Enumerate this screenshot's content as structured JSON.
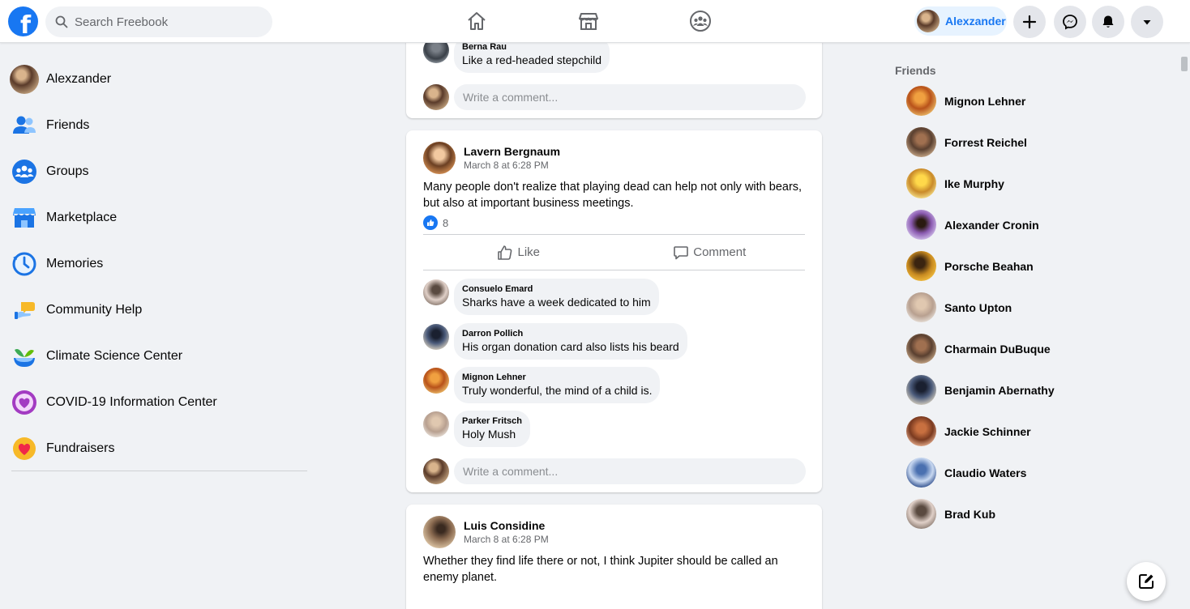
{
  "app": {
    "logo_letter": "f",
    "search_placeholder": "Search Freebook",
    "user_name": "Alexzander",
    "brand_color": "#1877f2"
  },
  "leftnav": {
    "items": [
      {
        "label": "Alexzander",
        "icon": "profile-avatar"
      },
      {
        "label": "Friends",
        "icon": "friends-icon"
      },
      {
        "label": "Groups",
        "icon": "groups-icon"
      },
      {
        "label": "Marketplace",
        "icon": "marketplace-icon"
      },
      {
        "label": "Memories",
        "icon": "memories-icon"
      },
      {
        "label": "Community Help",
        "icon": "community-help-icon"
      },
      {
        "label": "Climate Science Center",
        "icon": "climate-icon"
      },
      {
        "label": "COVID-19 Information Center",
        "icon": "covid-icon"
      },
      {
        "label": "Fundraisers",
        "icon": "fundraisers-icon"
      }
    ]
  },
  "feed": {
    "post0": {
      "comments": [
        {
          "name": "Berna Rau",
          "text": "Like a red-headed stepchild"
        }
      ],
      "write_placeholder": "Write a comment..."
    },
    "post1": {
      "author": "Lavern Bergnaum",
      "date": "March 8 at 6:28 PM",
      "text": "Many people don't realize that playing dead can help not only with bears, but also at important business meetings.",
      "like_count": "8",
      "like_label": "Like",
      "comment_label": "Comment",
      "comments": [
        {
          "name": "Consuelo Emard",
          "text": "Sharks have a week dedicated to him"
        },
        {
          "name": "Darron Pollich",
          "text": "His organ donation card also lists his beard"
        },
        {
          "name": "Mignon Lehner",
          "text": "Truly wonderful, the mind of a child is."
        },
        {
          "name": "Parker Fritsch",
          "text": "Holy Mush"
        }
      ],
      "write_placeholder": "Write a comment..."
    },
    "post2": {
      "author": "Luis Considine",
      "date": "March 8 at 6:28 PM",
      "text": "Whether they find life there or not, I think Jupiter should be called an enemy planet."
    }
  },
  "friends": {
    "heading": "Friends",
    "list": [
      "Mignon Lehner",
      "Forrest Reichel",
      "Ike Murphy",
      "Alexander Cronin",
      "Porsche Beahan",
      "Santo Upton",
      "Charmain DuBuque",
      "Benjamin Abernathy",
      "Jackie Schinner",
      "Claudio Waters",
      "Brad Kub"
    ]
  }
}
